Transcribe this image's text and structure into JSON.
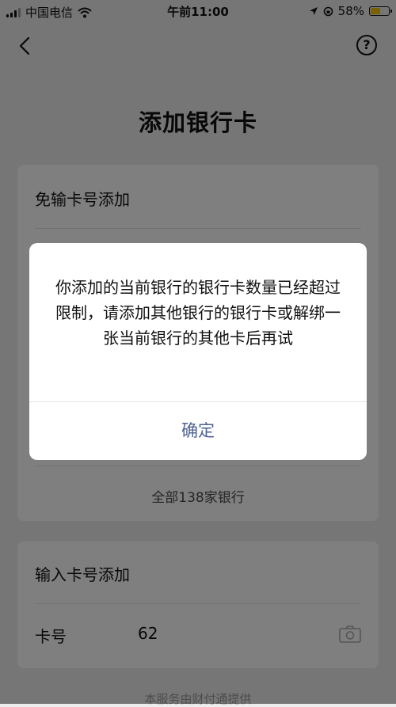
{
  "status_bar": {
    "carrier": "中国电信",
    "time": "午前11:00",
    "battery": "58%",
    "battery_level": 0.58,
    "battery_color": "#f5c400"
  },
  "nav": {
    "back_icon": "chevron-left-icon",
    "help_label": "?"
  },
  "page": {
    "title": "添加银行卡"
  },
  "quick_add": {
    "title": "免输卡号添加",
    "all_banks": "全部138家银行"
  },
  "manual_add": {
    "title": "输入卡号添加",
    "card_label": "卡号",
    "card_value": "62",
    "camera_icon": "camera-icon"
  },
  "footer": {
    "text": "本服务由财付通提供"
  },
  "dialog": {
    "message": "你添加的当前银行的银行卡数量已经超过限制，请添加其他银行的银行卡或解绑一张当前银行的其他卡后再试",
    "confirm_label": "确定",
    "confirm_color": "#4e6390"
  }
}
